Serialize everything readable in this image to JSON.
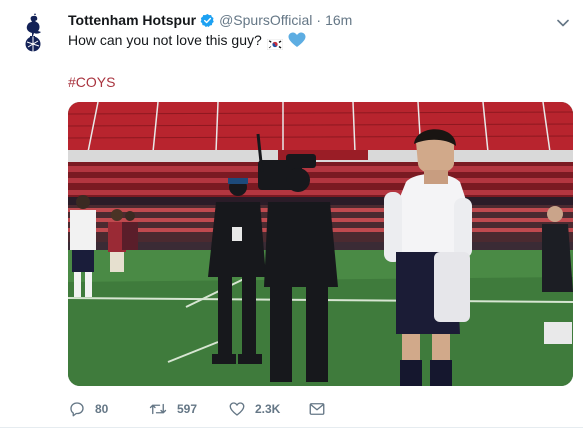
{
  "tweet": {
    "author": {
      "name": "Tottenham Hotspur",
      "handle": "@SpursOfficial",
      "separator": "·",
      "time": "16m",
      "verified": true,
      "avatar_icon": "spurs-cockerel-logo"
    },
    "text": "How can you not love this guy?",
    "emojis": [
      "south-korea-flag-icon",
      "blue-heart-icon"
    ],
    "hashtag": "#COYS",
    "media": {
      "type": "video-frame",
      "description_icon": "stadium-photo"
    },
    "actions": {
      "reply": {
        "count": "80",
        "icon": "reply-icon"
      },
      "retweet": {
        "count": "597",
        "icon": "retweet-icon"
      },
      "like": {
        "count": "2.3K",
        "icon": "like-icon"
      },
      "dm": {
        "icon": "direct-message-icon"
      }
    }
  },
  "colors": {
    "text": "#14171a",
    "secondary": "#657786",
    "verified": "#1da1f2",
    "hashtag": "#a9343f",
    "heart": "#5dade2"
  }
}
